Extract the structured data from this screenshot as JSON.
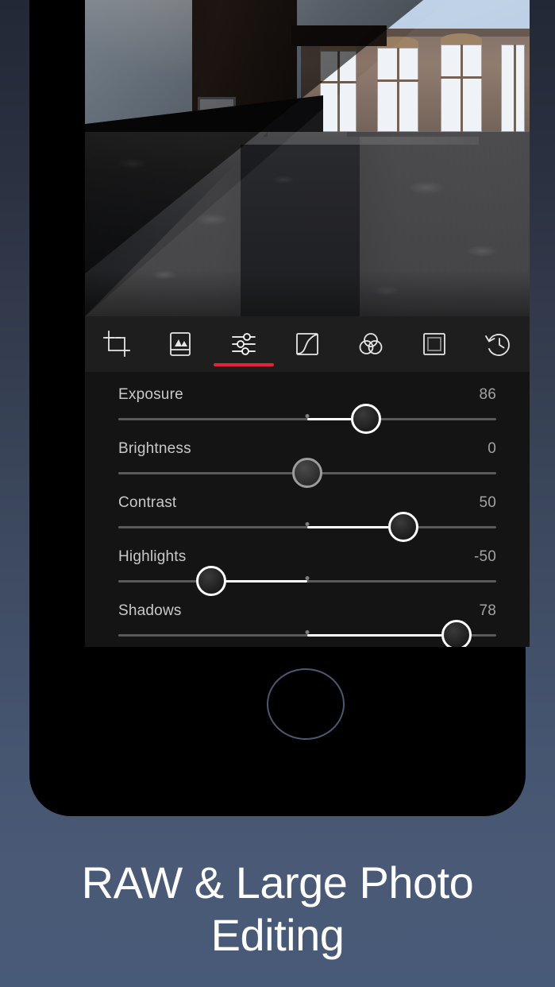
{
  "caption": {
    "line1": "RAW & Large Photo",
    "line2": "Editing"
  },
  "theme": {
    "accent": "#e8203a",
    "toolbar_bg": "#1e1e1e",
    "panel_bg": "#141414",
    "label_color": "#c9c9c9",
    "value_color": "#a3a3a3",
    "track_color": "#5a5a5a",
    "fill_color": "#ffffff",
    "background_top": "#232836",
    "background_bottom": "#475a77"
  },
  "photo": {
    "subject": "ruined stone building with arched windows and a stone trench",
    "comparison": "diagonal before-after split"
  },
  "toolbar": {
    "active_index": 2,
    "items": [
      {
        "name": "crop-icon",
        "label": "Crop"
      },
      {
        "name": "presets-icon",
        "label": "Presets"
      },
      {
        "name": "adjust-icon",
        "label": "Adjust"
      },
      {
        "name": "curves-icon",
        "label": "Curves"
      },
      {
        "name": "color-mixer-icon",
        "label": "Color"
      },
      {
        "name": "frame-icon",
        "label": "Frame"
      },
      {
        "name": "history-icon",
        "label": "History"
      }
    ]
  },
  "adjustments": [
    {
      "label": "Exposure",
      "value": "86",
      "percent": 65.5,
      "fill_from": 50
    },
    {
      "label": "Brightness",
      "value": "0",
      "percent": 50,
      "fill_from": 50
    },
    {
      "label": "Contrast",
      "value": "50",
      "percent": 75.5,
      "fill_from": 50
    },
    {
      "label": "Highlights",
      "value": "-50",
      "percent": 24.5,
      "fill_from": 50
    },
    {
      "label": "Shadows",
      "value": "78",
      "percent": 89.5,
      "fill_from": 50
    }
  ]
}
